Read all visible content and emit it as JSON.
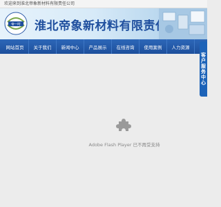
{
  "topbar": {
    "welcome": "欢迎来到淮北帝象新材料有限责任公司"
  },
  "header": {
    "company_name": "淮北帝象新材料有限责任公司",
    "logo_text": "帝一时"
  },
  "nav": {
    "items": [
      {
        "label": "网站首页"
      },
      {
        "label": "关于我们"
      },
      {
        "label": "新闻中心"
      },
      {
        "label": "产品展示"
      },
      {
        "label": "在线咨询"
      },
      {
        "label": "使用案例"
      },
      {
        "label": "人力资源"
      }
    ]
  },
  "flash": {
    "message": "Adobe Flash Player 已不再受支持"
  },
  "service": {
    "label": "客户服务中心"
  },
  "colors": {
    "nav_bg": "#1d4f9c",
    "brand_text": "#1f4f9e",
    "service_tab": "#1d63b8"
  }
}
